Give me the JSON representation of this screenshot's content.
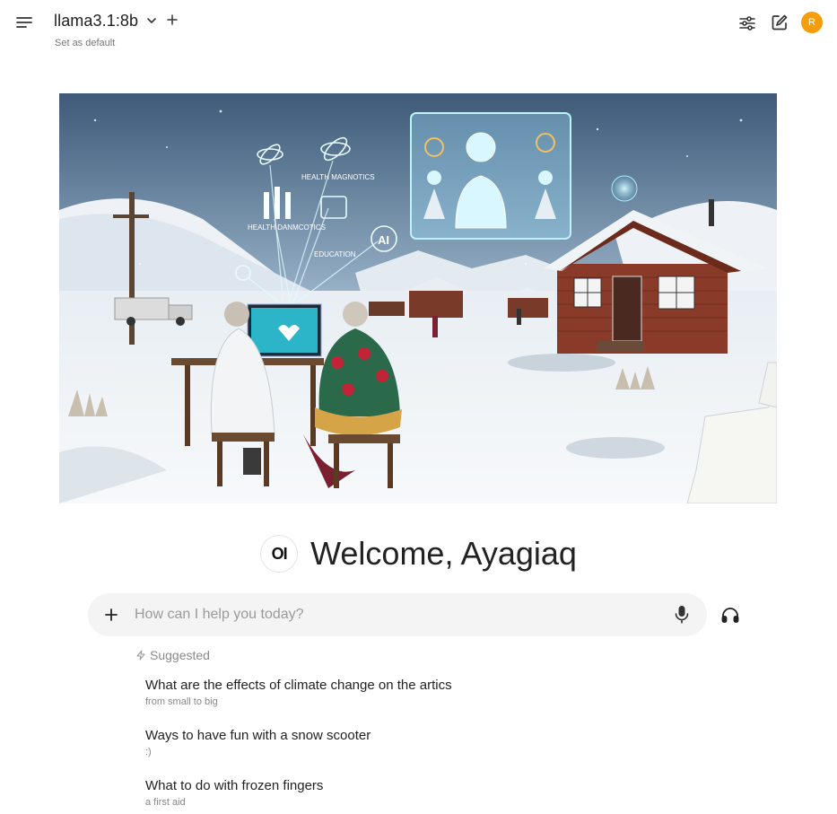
{
  "header": {
    "model_name": "llama3.1:8b",
    "set_default": "Set as default",
    "avatar_initial": "R"
  },
  "icons": {
    "menu": "hamburger-menu-icon",
    "model_dropdown": "chevron-down-icon",
    "add_model": "plus-icon",
    "controls": "sliders-icon",
    "new_chat": "edit-icon",
    "attach": "plus-icon",
    "voice_input": "microphone-icon",
    "voice_mode": "headphones-icon",
    "suggested": "lightning-icon"
  },
  "colors": {
    "avatar": "#f59e0b",
    "input_bg": "#f4f4f4"
  },
  "welcome": {
    "logo_text": "OI",
    "text": "Welcome, Ayagiaq"
  },
  "banner": {
    "overlay_labels": [
      "HEALTH MAGNOTICS",
      "HEALTH DANMCOTICS",
      "EDUCATION",
      "AI"
    ]
  },
  "prompt": {
    "placeholder": "How can I help you today?",
    "value": ""
  },
  "suggested": {
    "label": "Suggested",
    "items": [
      {
        "title": "What are the effects of climate change on the artics",
        "subtitle": "from small to big"
      },
      {
        "title": "Ways to have fun with a snow scooter",
        "subtitle": ":)"
      },
      {
        "title": "What to do with frozen fingers",
        "subtitle": "a first aid"
      }
    ]
  }
}
